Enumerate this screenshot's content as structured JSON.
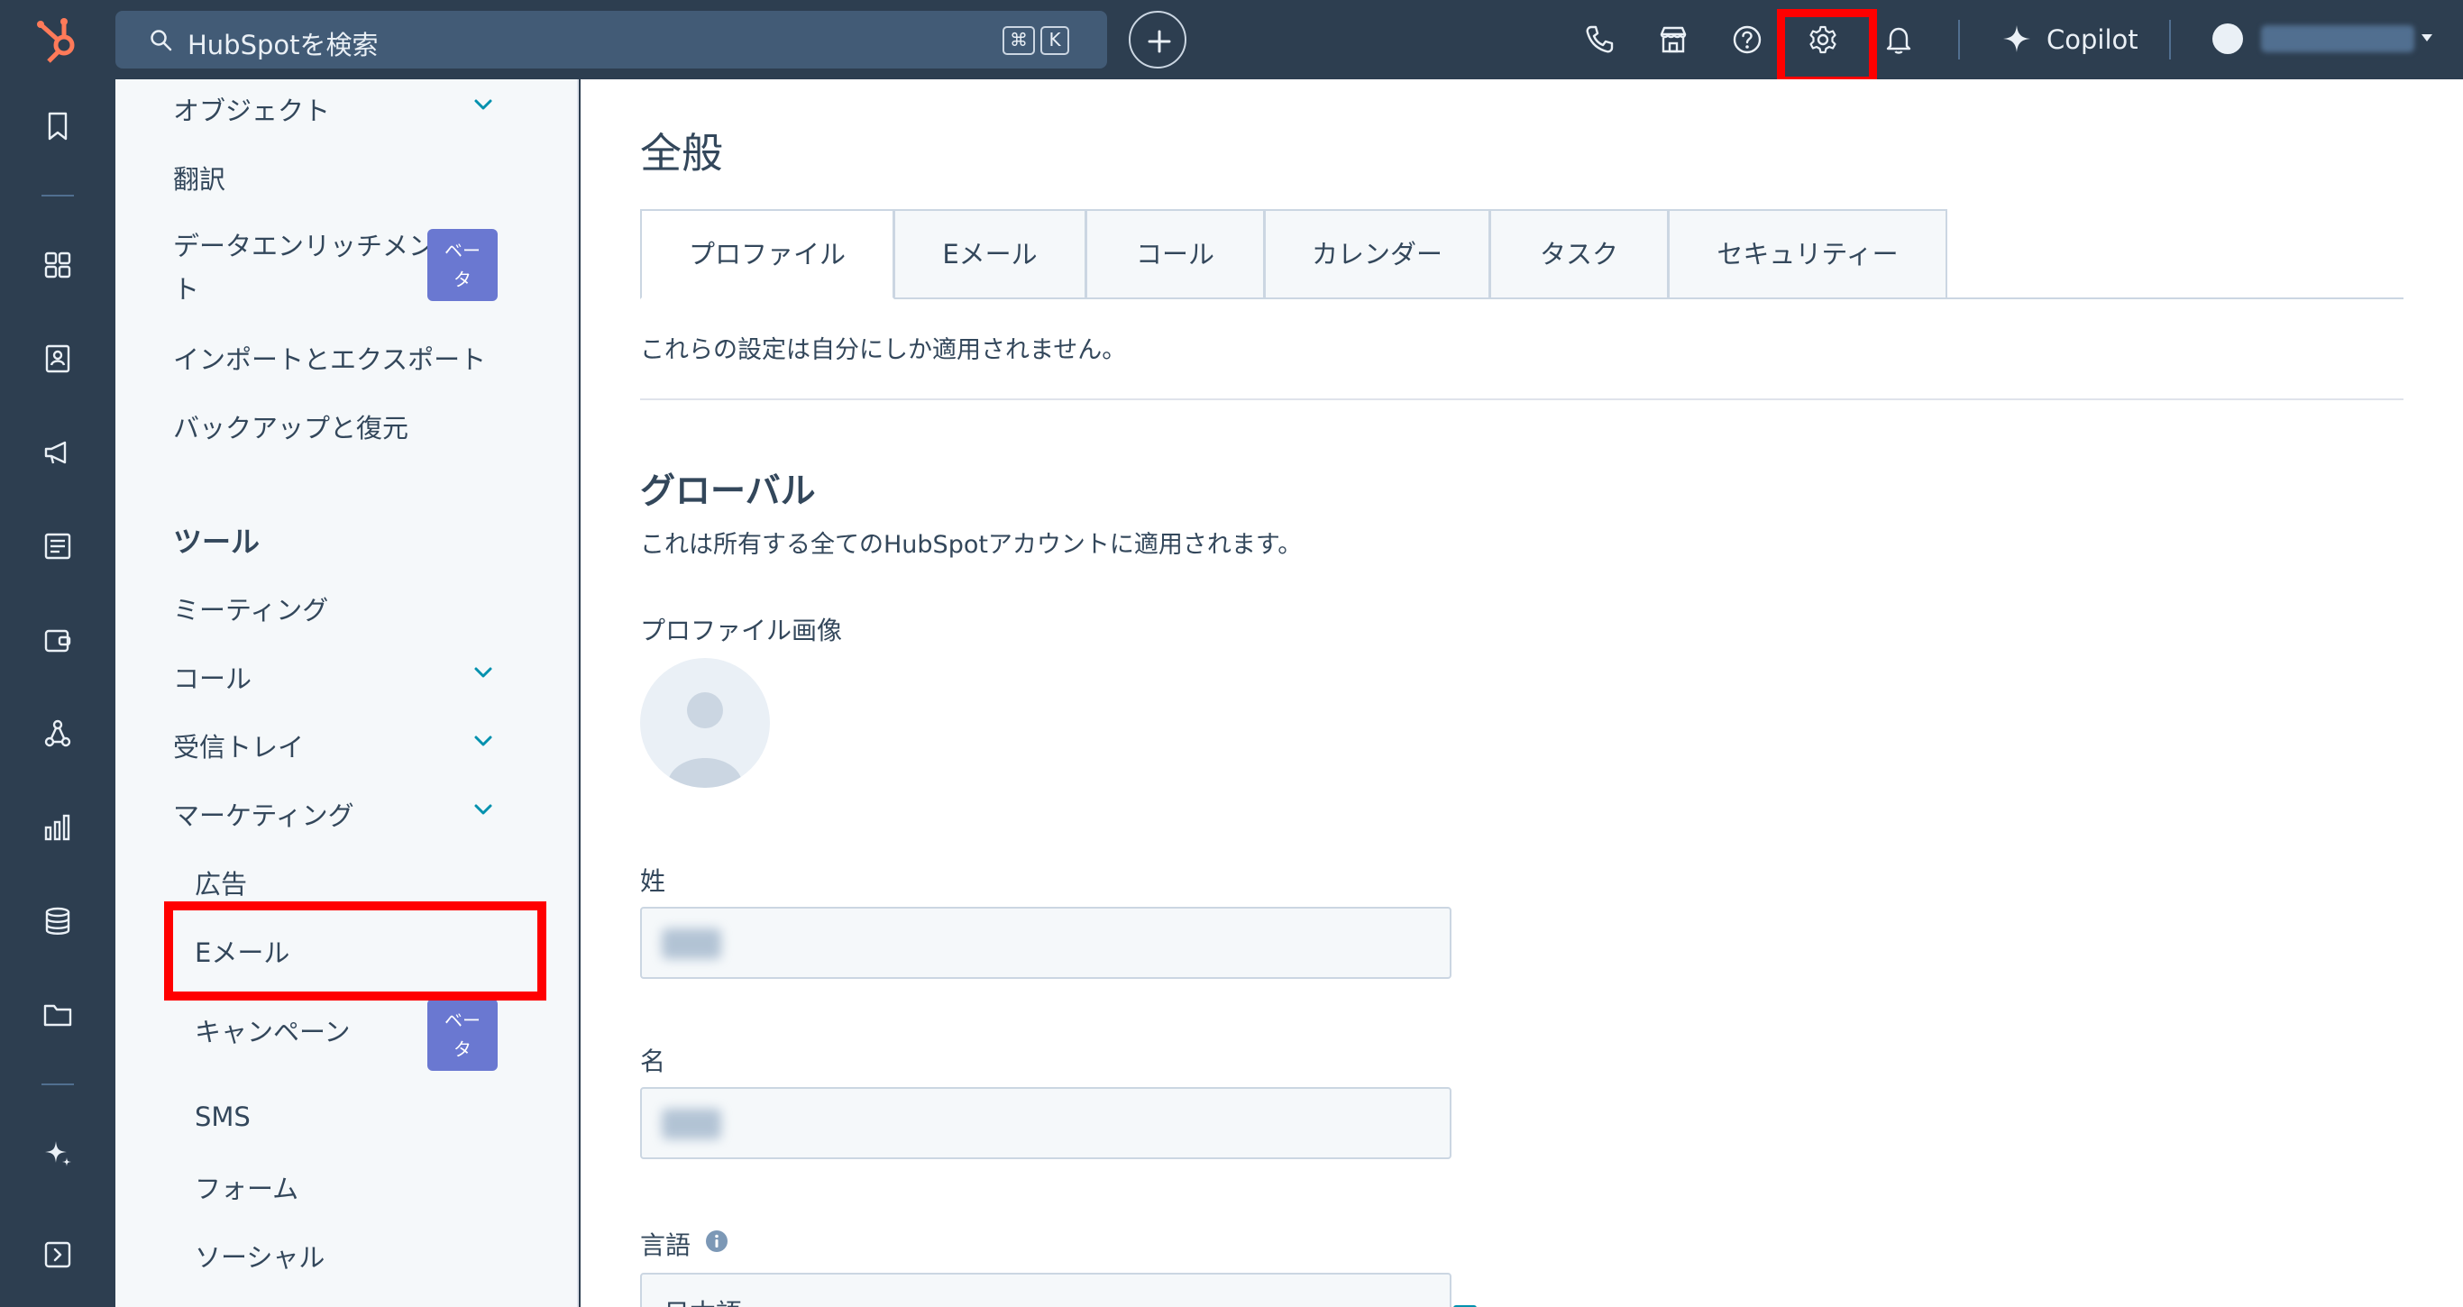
{
  "topbar": {
    "search_placeholder": "HubSpotを検索",
    "shortcut_key1": "⌘",
    "shortcut_key2": "K",
    "copilot_label": "Copilot"
  },
  "sidenav": {
    "items_top": [
      {
        "label": "オブジェクト",
        "chevron": true
      },
      {
        "label": "翻訳"
      },
      {
        "label_line1": "データエンリッチメン",
        "label_line2": "ト",
        "badge": "ベー\nタ"
      },
      {
        "label": "インポートとエクスポート"
      },
      {
        "label": "バックアップと復元"
      }
    ],
    "tools_title": "ツール",
    "tools": {
      "meetings": "ミーティング",
      "calls": "コール",
      "inbox": "受信トレイ",
      "marketing": "マーケティング",
      "ads": "広告",
      "email": "Eメール",
      "campaigns": "キャンペーン",
      "sms": "SMS",
      "forms": "フォーム",
      "social": "ソーシャル"
    },
    "beta_line1": "ベー",
    "beta_line2": "タ"
  },
  "main": {
    "title": "全般",
    "tabs": [
      "プロファイル",
      "Eメール",
      "コール",
      "カレンダー",
      "タスク",
      "セキュリティー"
    ],
    "note": "これらの設定は自分にしか適用されません。",
    "section_title": "グローバル",
    "section_desc": "これは所有する全てのHubSpotアカウントに適用されます。",
    "profile_image_label": "プロファイル画像",
    "last_name_label": "姓",
    "first_name_label": "名",
    "language_label": "言語",
    "language_value": "日本語"
  },
  "colors": {
    "topbar_bg": "#2d3e50",
    "accent": "#0091ae",
    "beta_badge": "#6a78d1",
    "highlight": "#ff0000"
  }
}
